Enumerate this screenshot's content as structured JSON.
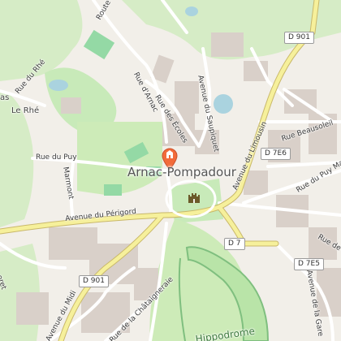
{
  "map": {
    "poi_marker": "map-pin-icon",
    "castle_symbol": "castle-icon",
    "colors": {
      "background": "#f2efe9",
      "park": "#c8eab9",
      "sports": "#94d9a5",
      "water": "#aad3df",
      "major_road": "#f6f09b",
      "minor_road": "#ffffff",
      "building": "#d9d0c9",
      "marker": "#f26b3a"
    }
  },
  "labels": {
    "town": "Arnac-Pompadour",
    "le_rhe": "Le Rhé",
    "rue_du_rhe": "Rue du Rhé",
    "as": "as",
    "route_des": "Route des",
    "rue_darnac": "Rue d'Arnac",
    "rue_des_ecoles": "Rue des Écoles",
    "avenue_du_saupiquet": "Avenue du Saupiquet",
    "avenue_du_limousin": "Avenue du Limousin",
    "rue_beausoleil": "Rue Beausoleil",
    "rue_du_puy": "Rue du Puy",
    "marmont": "Marmont",
    "avenue_du_perigord": "Avenue du Périgord",
    "rue_du_puy_marlot": "Rue du Puy Marlot",
    "rue_de_cheno": "Rue de Cheno",
    "avenue_de_la_gare": "Avenue de la Gare",
    "avenue_du_midi": "Avenue du Midi",
    "rue_de_la_chataigneraie": "Rue de la Châtaigneraie",
    "hippodrome": "Hippodrome",
    "foret": "oret"
  },
  "shields": {
    "d901_top": "D 901",
    "d7e6": "D 7E6",
    "d7": "D 7",
    "d7e5": "D 7E5",
    "d901_bottom": "D 901"
  }
}
